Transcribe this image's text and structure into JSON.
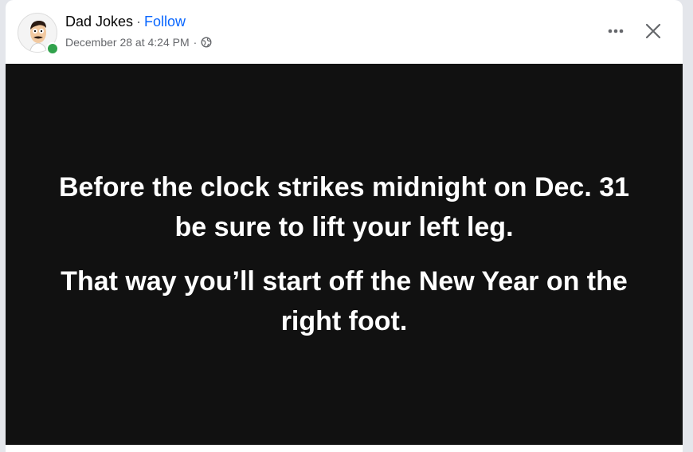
{
  "post": {
    "author": "Dad Jokes",
    "separator": "·",
    "follow_label": "Follow",
    "timestamp": "December 28 at 4:24 PM",
    "privacy_icon": "globe-icon",
    "more_icon": "more-options-icon",
    "close_icon": "close-icon"
  },
  "image_text": {
    "paragraph1": "Before the clock strikes midnight on Dec. 31 be sure to lift your left leg.",
    "paragraph2": "That way you’ll start off the New Year on the right foot."
  },
  "colors": {
    "link": "#0866ff",
    "online": "#31a24c",
    "image_background": "#111111",
    "meta_text": "#65676b"
  }
}
